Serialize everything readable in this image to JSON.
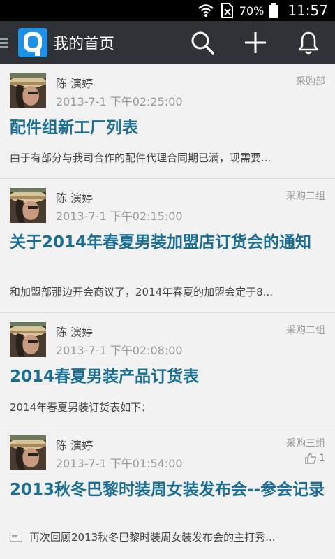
{
  "status_bar": {
    "battery": "70%",
    "time": "11:57"
  },
  "action_bar": {
    "title": "我的首页"
  },
  "posts": [
    {
      "author": "陈 演婷",
      "time": "2013-7-1 下午02:25:00",
      "dept": "采购部",
      "title": "配件组新工厂列表",
      "summary": "由于有部分与我司合作的配件代理合同期已满，现需要..."
    },
    {
      "author": "陈 演婷",
      "time": "2013-7-1 下午02:15:00",
      "dept": "采购二组",
      "title": "关于2014年春夏男装加盟店订货会的通知",
      "summary": "和加盟部那边开会商议了，2014年春夏的加盟会定于8..."
    },
    {
      "author": "陈 演婷",
      "time": "2013-7-1 下午02:08:00",
      "dept": "采购二组",
      "title": "2014春夏男装产品订货表",
      "summary": "2014年春夏男装订货表如下："
    },
    {
      "author": "陈 演婷",
      "time": "2013-7-1 下午01:54:00",
      "dept": "采购三组",
      "likes": "1",
      "title": "2013秋冬巴黎时装周女装发布会--参会记录",
      "summary": "再次回顾2013秋冬巴黎时装周女装发布会的主打秀..."
    }
  ],
  "colors": {
    "title_blue": "#1a6d93",
    "action_bar": "#2f3236",
    "logo_blue": "#1e90e6"
  }
}
